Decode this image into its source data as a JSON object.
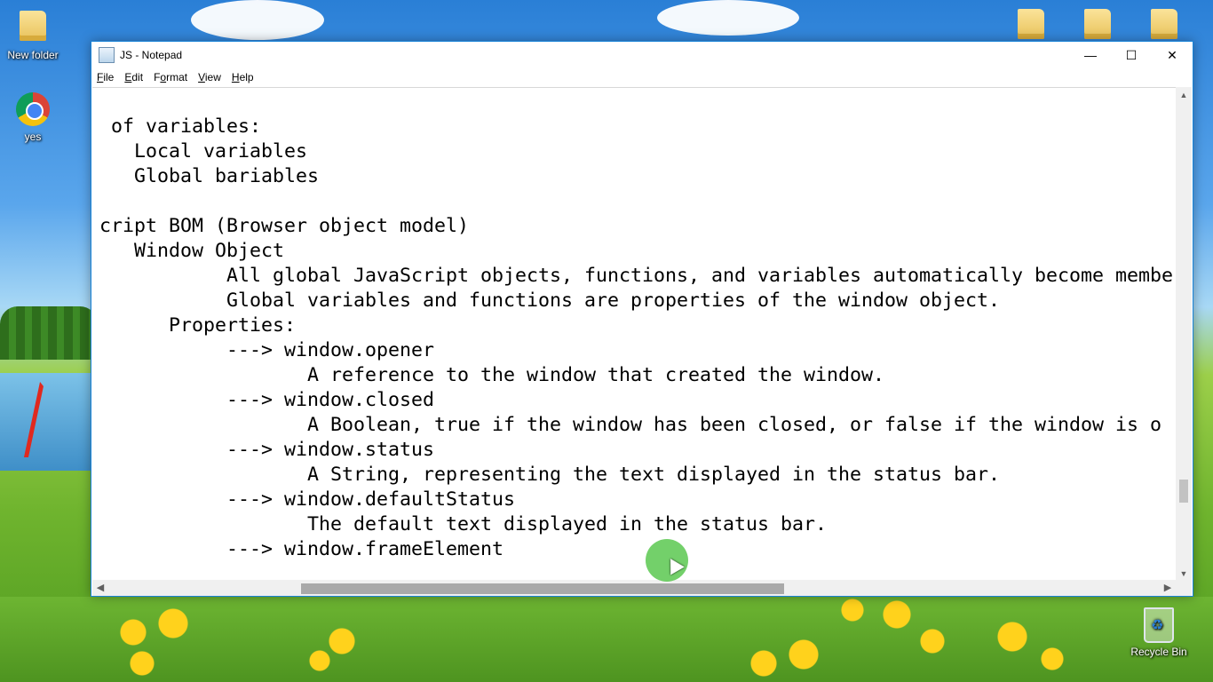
{
  "desktop": {
    "icons": [
      {
        "label": "New folder",
        "icon": "folder-icon"
      },
      {
        "label": "yes",
        "icon": "chrome-icon"
      },
      {
        "label": "Recycle Bin",
        "icon": "recycle-bin-icon"
      }
    ],
    "top_right_folders": [
      "folder-icon",
      "folder-icon",
      "folder-icon"
    ]
  },
  "window": {
    "title": "JS - Notepad",
    "controls": {
      "minimize": "—",
      "maximize": "☐",
      "close": "✕"
    },
    "menu": [
      {
        "label": "File",
        "accel": "F",
        "rest": "ile"
      },
      {
        "label": "Edit",
        "accel": "E",
        "rest": "dit"
      },
      {
        "label": "Format",
        "accel": "o",
        "pre": "F",
        "rest": "rmat"
      },
      {
        "label": "View",
        "accel": "V",
        "rest": "iew"
      },
      {
        "label": "Help",
        "accel": "H",
        "rest": "elp"
      }
    ],
    "content": " of variables:\n   Local variables\n   Global bariables\n\ncript BOM (Browser object model)\n   Window Object\n           All global JavaScript objects, functions, and variables automatically become membe\n           Global variables and functions are properties of the window object.\n      Properties:\n           ---> window.opener\n                  A reference to the window that created the window.\n           ---> window.closed\n                  A Boolean, true if the window has been closed, or false if the window is o\n           ---> window.status\n                  A String, representing the text displayed in the status bar.\n           ---> window.defaultStatus\n                  The default text displayed in the status bar.\n           ---> window.frameElement",
    "scrollbar_arrows": {
      "up": "▲",
      "down": "▼",
      "left": "◀",
      "right": "▶"
    }
  },
  "colors": {
    "window_border": "#1883d7",
    "cursor_ring": "#5ac850"
  }
}
